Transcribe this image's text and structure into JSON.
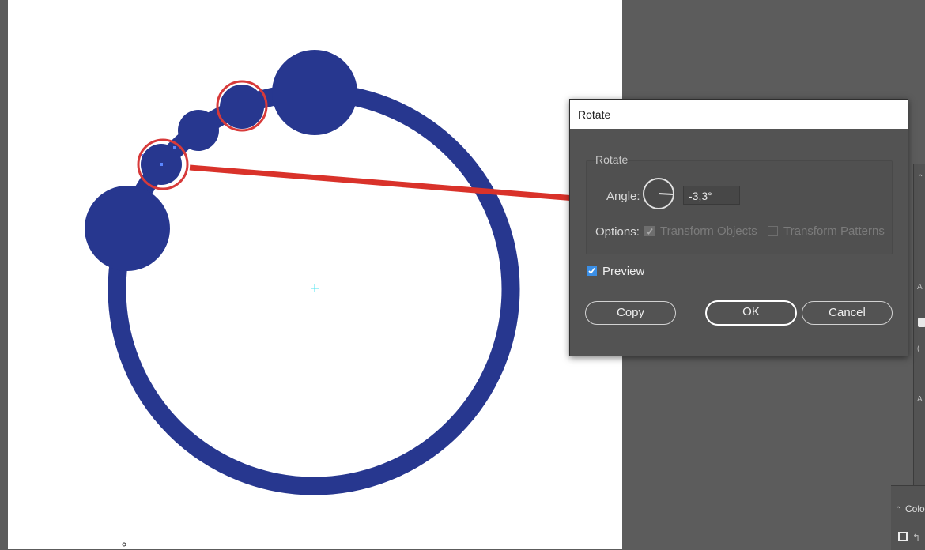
{
  "canvas": {
    "shape_color": "#27378f",
    "guide_color": "#4ee3ef",
    "highlight_color": "#d73a3a"
  },
  "dialog": {
    "title": "Rotate",
    "group_label": "Rotate",
    "angle_label": "Angle:",
    "angle_value": "-3,3°",
    "options_label": "Options:",
    "transform_objects_label": "Transform Objects",
    "transform_patterns_label": "Transform Patterns",
    "transform_objects_checked": true,
    "transform_patterns_checked": false,
    "preview_label": "Preview",
    "preview_checked": true,
    "copy_label": "Copy",
    "ok_label": "OK",
    "cancel_label": "Cancel"
  },
  "right_panel": {
    "color_tab_label": "Colo"
  },
  "annotation": {
    "arrow_color": "#d9322a"
  }
}
